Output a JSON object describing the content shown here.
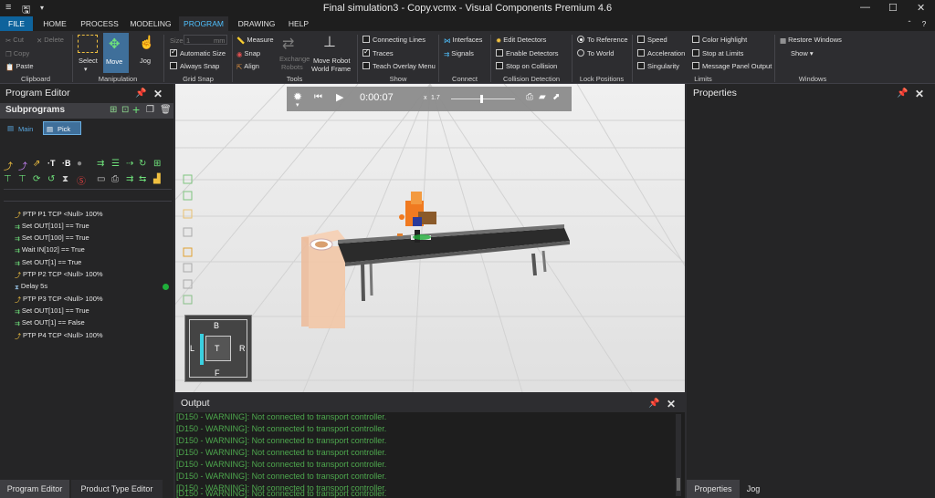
{
  "window": {
    "title": "Final simulation3 - Copy.vcmx - Visual Components Premium 4.6",
    "minimize": "—",
    "maximize": "☐",
    "close": "✕",
    "restore_small": "ˆ",
    "help": "?"
  },
  "menu": {
    "file": "FILE",
    "home": "HOME",
    "process": "PROCESS",
    "modeling": "MODELING",
    "program": "PROGRAM",
    "drawing": "DRAWING",
    "help": "HELP"
  },
  "ribbon": {
    "clipboard": {
      "cut": "Cut",
      "delete": "Delete",
      "copy": "Copy",
      "paste": "Paste",
      "label": "Clipboard"
    },
    "manipulation": {
      "select": "Select",
      "move": "Move",
      "jog": "Jog",
      "label": "Manipulation"
    },
    "grid_snap": {
      "size_label": "Size",
      "size_value": "1",
      "size_unit": "mm",
      "automatic_size": "Automatic Size",
      "always_snap": "Always Snap",
      "label": "Grid Snap"
    },
    "tools": {
      "measure": "Measure",
      "snap": "Snap",
      "align": "Align",
      "exchange_robots_1": "Exchange",
      "exchange_robots_2": "Robots",
      "move_robot_1": "Move Robot",
      "move_robot_2": "World Frame",
      "label": "Tools"
    },
    "show": {
      "connecting_lines": "Connecting Lines",
      "traces": "Traces",
      "teach_overlay_menu": "Teach Overlay Menu",
      "label": "Show"
    },
    "connect": {
      "interfaces": "Interfaces",
      "signals": "Signals",
      "label": "Connect"
    },
    "collision": {
      "edit_detectors": "Edit Detectors",
      "enable_detectors": "Enable Detectors",
      "stop_on_collision": "Stop on Collision",
      "label": "Collision Detection"
    },
    "lock_positions": {
      "to_reference": "To Reference",
      "to_world": "To World",
      "label": "Lock Positions"
    },
    "limits": {
      "speed": "Speed",
      "acceleration": "Acceleration",
      "singularity": "Singularity",
      "color_highlight": "Color Highlight",
      "stop_at_limits": "Stop at Limits",
      "message_panel_output": "Message Panel Output",
      "label": "Limits"
    },
    "windows": {
      "restore_windows": "Restore Windows",
      "show": "Show",
      "label": "Windows"
    }
  },
  "program_editor": {
    "title": "Program Editor",
    "subprograms": "Subprograms",
    "tabs": [
      "Main",
      "Pick"
    ],
    "statements": [
      "PTP P1 TCP <Null> 100%",
      "Set OUT[101] == True",
      "Set OUT[100] == True",
      "Wait IN[102] == True",
      "Set OUT[1] == True",
      "PTP P2 TCP <Null> 100%",
      "Delay 5s",
      "PTP P3 TCP <Null> 100%",
      "Set OUT[101] == True",
      "Set OUT[1] == False",
      "PTP P4 TCP <Null> 100%"
    ]
  },
  "bottom_tabs": {
    "program_editor": "Program Editor",
    "product_type_editor": "Product Type Editor",
    "properties": "Properties",
    "jog": "Jog"
  },
  "sim_controls": {
    "time": "0:00:07",
    "speed": "1.7",
    "speed_label": "x"
  },
  "view_cube": {
    "top": "B",
    "left": "L",
    "center": "T",
    "right": "R",
    "bottom": "F"
  },
  "output": {
    "title": "Output",
    "lines": [
      "[D150 - WARNING]: Not connected to transport controller.",
      "[D150 - WARNING]: Not connected to transport controller.",
      "[D150 - WARNING]: Not connected to transport controller.",
      "[D150 - WARNING]: Not connected to transport controller.",
      "[D150 - WARNING]: Not connected to transport controller.",
      "[D150 - WARNING]: Not connected to transport controller.",
      "[D150 - WARNING]: Not connected to transport controller.",
      "[D150 - WARNING]: Not connected to transport controller."
    ]
  },
  "properties": {
    "title": "Properties"
  },
  "icons": {
    "pin": "pin-icon",
    "close": "close-icon"
  },
  "colors": {
    "accent": "#0e639c",
    "active_tab": "#4fc1ff",
    "warning_text": "#4ea84e",
    "panel_bg": "#252526",
    "ribbon_bg": "#2d2d30"
  }
}
